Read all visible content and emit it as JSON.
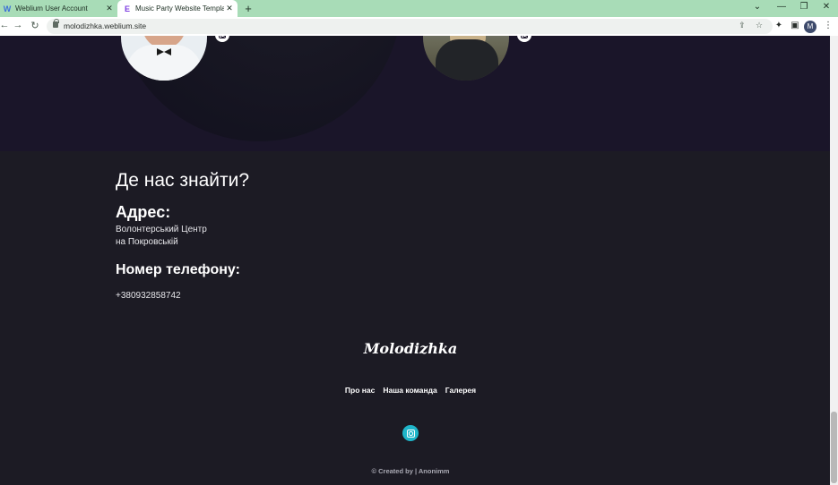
{
  "browser": {
    "tabs": [
      {
        "title": "Weblium User Account",
        "favicon": "W"
      },
      {
        "title": "Music Party Website Template De",
        "favicon": "E"
      }
    ],
    "new_tab": "+",
    "url": "molodizhka.weblium.site",
    "profile_initial": "M",
    "controls": {
      "minimize": "⌄",
      "restore": "—",
      "maximize": "❐",
      "close": "✕"
    }
  },
  "team": {
    "member_icons": [
      "instagram-icon",
      "instagram-icon"
    ]
  },
  "contacts": {
    "heading": "Де нас знайти?",
    "address_heading": "Адрес:",
    "address_lines": [
      "Волонтерський Центр",
      "на Покровській"
    ],
    "phone_heading": "Номер телефону:",
    "phone": "+380932858742"
  },
  "footer": {
    "logo": "Molodizhka",
    "menu": [
      "Про нас",
      "Наша команда",
      "Галерея"
    ],
    "social_icon": "instagram-icon",
    "credits": "© Created by | Anonimm"
  },
  "colors": {
    "tab_bar": "#a8dcb7",
    "team_bg": "#1a1529",
    "page_bg": "#1c1b24",
    "accent": "#1fb5c9"
  }
}
